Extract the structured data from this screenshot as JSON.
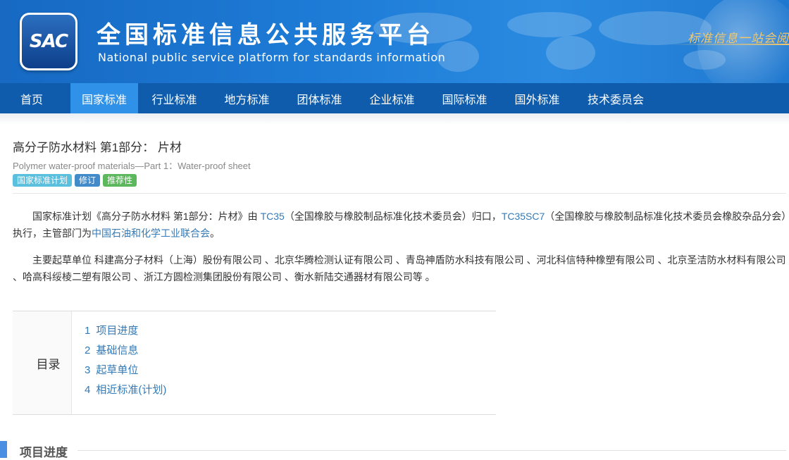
{
  "header": {
    "logo_text": "SAC",
    "title": "全国标准信息公共服务平台",
    "subtitle": "National public service platform  for standards information",
    "slogan": "标准信息一站会阅"
  },
  "nav": {
    "items": [
      {
        "label": "首页"
      },
      {
        "label": "国家标准",
        "active": true
      },
      {
        "label": "行业标准"
      },
      {
        "label": "地方标准"
      },
      {
        "label": "团体标准"
      },
      {
        "label": "企业标准"
      },
      {
        "label": "国际标准"
      },
      {
        "label": "国外标准"
      },
      {
        "label": "技术委员会"
      }
    ]
  },
  "standard": {
    "title_zh": "高分子防水材料 第1部分： 片材",
    "title_en": "Polymer water-proof materials—Part 1：Water-proof sheet",
    "tags": [
      "国家标准计划",
      "修订",
      "推荐性"
    ]
  },
  "description": {
    "p1_prefix": "国家标准计划《高分子防水材料 第1部分：片材》由 ",
    "tc1_link": "TC35",
    "p1_mid1": "（全国橡胶与橡胶制品标准化技术委员会）归口，",
    "tc2_link": "TC35SC7",
    "p1_mid2": "（全国橡胶与橡胶制品标准化技术委员会橡胶杂品分会）执行，主管部门为",
    "dept_link": "中国石油和化学工业联合会",
    "p1_suffix": "。",
    "p2": "主要起草单位 科建高分子材料（上海）股份有限公司 、北京华腾检测认证有限公司 、青岛神盾防水科技有限公司 、河北科信特种橡塑有限公司 、北京圣洁防水材料有限公司 、哈高科绥棱二塑有限公司 、浙江方圆检测集团股份有限公司 、衡水新陆交通器材有限公司等 。"
  },
  "toc": {
    "label": "目录",
    "items": [
      {
        "num": "1",
        "label": "项目进度"
      },
      {
        "num": "2",
        "label": "基础信息"
      },
      {
        "num": "3",
        "label": "起草单位"
      },
      {
        "num": "4",
        "label": "相近标准(计划)"
      }
    ]
  },
  "section": {
    "title": "项目进度"
  },
  "colors": {
    "nav_bg": "#0f5cad",
    "nav_active": "#2f92e8",
    "link": "#337ab7",
    "tag_plan": "#5bc0de",
    "tag_revise": "#428bca",
    "tag_recommend": "#5cb85c"
  }
}
